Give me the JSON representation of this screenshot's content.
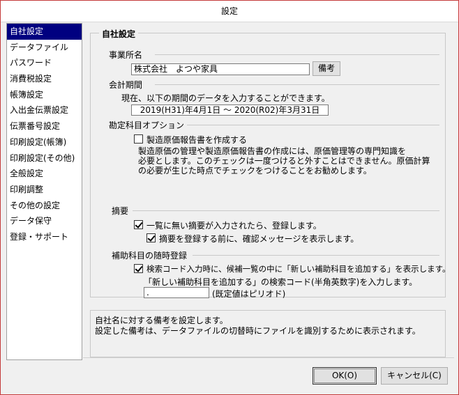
{
  "window": {
    "title": "設定"
  },
  "sidebar": {
    "items": [
      {
        "label": "自社設定",
        "selected": true
      },
      {
        "label": "データファイル"
      },
      {
        "label": "パスワード"
      },
      {
        "label": "消費税設定"
      },
      {
        "label": "帳簿設定"
      },
      {
        "label": "入出金伝票設定"
      },
      {
        "label": "伝票番号設定"
      },
      {
        "label": "印刷設定(帳簿)"
      },
      {
        "label": "印刷設定(その他)"
      },
      {
        "label": "全般設定"
      },
      {
        "label": "印刷調整"
      },
      {
        "label": "その他の設定"
      },
      {
        "label": "データ保守"
      },
      {
        "label": "登録・サポート"
      }
    ]
  },
  "main": {
    "group_title": "自社設定",
    "business_name": {
      "label": "事業所名",
      "value": "株式会社　よつや家具",
      "memo_button": "備考"
    },
    "fiscal_period": {
      "label": "会計期間",
      "description": "現在、以下の期間のデータを入力することができます。",
      "value": "2019(H31)年4月1日 ～ 2020(R02)年3月31日"
    },
    "account_options": {
      "label": "勘定科目オプション",
      "manufacturing_report_checkbox": {
        "label": "製造原価報告書を作成する",
        "checked": false
      },
      "note_lines": [
        "製造原価の管理や製造原価報告書の作成には、原価管理等の専門知識を",
        "必要とします。このチェックは一度つけると外すことはできません。原価計算",
        "の必要が生じた時点でチェックをつけることをお勧めします。"
      ]
    },
    "summary": {
      "label": "摘要",
      "register_unknown_checkbox": {
        "label": "一覧に無い摘要が入力されたら、登録します。",
        "checked": true
      },
      "confirm_checkbox": {
        "label": "摘要を登録する前に、確認メッセージを表示します。",
        "checked": true
      }
    },
    "sub_account": {
      "label": "補助科目の随時登録",
      "show_add_checkbox": {
        "label": "検索コード入力時に、候補一覧の中に「新しい補助科目を追加する」を表示します。",
        "checked": true
      },
      "code_instruction": "「新しい補助科目を追加する」の検索コード(半角英数字)を入力します。",
      "code_value": ".",
      "code_default_note": "(既定値はピリオド)"
    }
  },
  "info": {
    "lines": [
      "自社名に対する備考を設定します。",
      "設定した備考は、データファイルの切替時にファイルを識別するために表示されます。"
    ]
  },
  "footer": {
    "ok_label": "OK(O)",
    "cancel_label": "キャンセル(C)"
  }
}
